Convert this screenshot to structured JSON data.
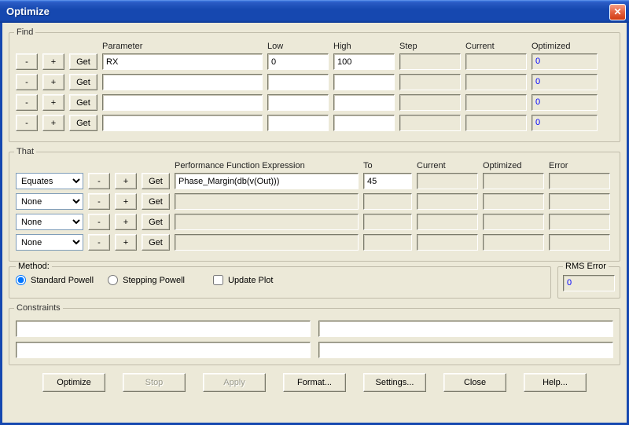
{
  "window": {
    "title": "Optimize"
  },
  "find": {
    "legend": "Find",
    "headers": {
      "parameter": "Parameter",
      "low": "Low",
      "high": "High",
      "step": "Step",
      "current": "Current",
      "optimized": "Optimized"
    },
    "buttons": {
      "minus": "-",
      "plus": "+",
      "get": "Get"
    },
    "rows": [
      {
        "parameter": "RX",
        "low": "0",
        "high": "100",
        "step": "",
        "current": "",
        "optimized": "0"
      },
      {
        "parameter": "",
        "low": "",
        "high": "",
        "step": "",
        "current": "",
        "optimized": "0"
      },
      {
        "parameter": "",
        "low": "",
        "high": "",
        "step": "",
        "current": "",
        "optimized": "0"
      },
      {
        "parameter": "",
        "low": "",
        "high": "",
        "step": "",
        "current": "",
        "optimized": "0"
      }
    ]
  },
  "that": {
    "legend": "That",
    "headers": {
      "expr": "Performance Function Expression",
      "to": "To",
      "current": "Current",
      "optimized": "Optimized",
      "error": "Error"
    },
    "buttons": {
      "minus": "-",
      "plus": "+",
      "get": "Get"
    },
    "rows": [
      {
        "mode": "Equates",
        "expr": "Phase_Margin(db(v(Out)))",
        "to": "45",
        "current": "",
        "optimized": "",
        "error": ""
      },
      {
        "mode": "None",
        "expr": "",
        "to": "",
        "current": "",
        "optimized": "",
        "error": ""
      },
      {
        "mode": "None",
        "expr": "",
        "to": "",
        "current": "",
        "optimized": "",
        "error": ""
      },
      {
        "mode": "None",
        "expr": "",
        "to": "",
        "current": "",
        "optimized": "",
        "error": ""
      }
    ],
    "mode_options": [
      "Equates",
      "None"
    ]
  },
  "method": {
    "legend": "Method:",
    "standard": "Standard Powell",
    "stepping": "Stepping Powell",
    "update_plot": "Update Plot",
    "selected": "standard"
  },
  "rms": {
    "legend": "RMS Error",
    "value": "0"
  },
  "constraints": {
    "legend": "Constraints",
    "values": [
      "",
      "",
      "",
      ""
    ]
  },
  "buttons": {
    "optimize": "Optimize",
    "stop": "Stop",
    "apply": "Apply",
    "format": "Format...",
    "settings": "Settings...",
    "close": "Close",
    "help": "Help..."
  }
}
